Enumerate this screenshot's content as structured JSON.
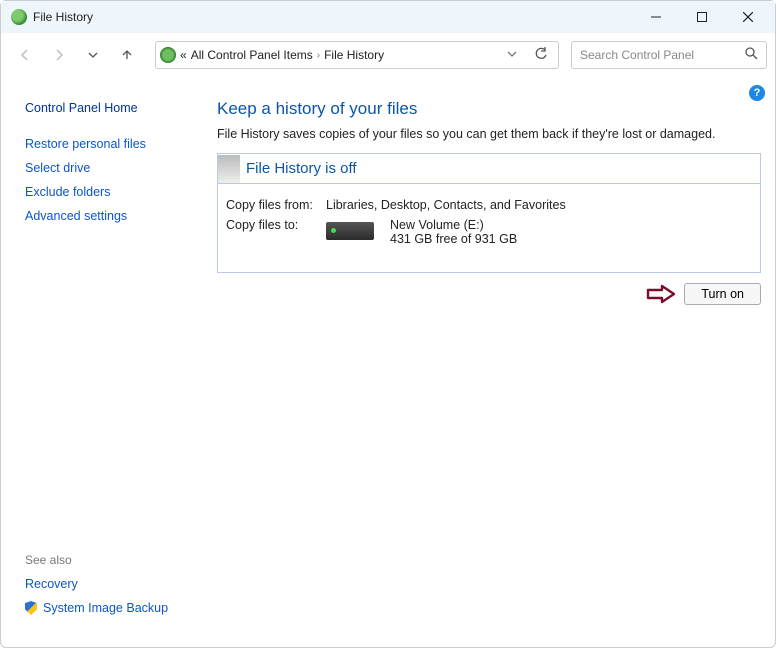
{
  "titlebar": {
    "title": "File History"
  },
  "breadcrumb": {
    "prefix": "«",
    "item1": "All Control Panel Items",
    "item2": "File History"
  },
  "search": {
    "placeholder": "Search Control Panel"
  },
  "sidebar": {
    "home": "Control Panel Home",
    "links": {
      "restore": "Restore personal files",
      "select_drive": "Select drive",
      "exclude": "Exclude folders",
      "advanced": "Advanced settings"
    },
    "see_also_label": "See also",
    "footer": {
      "recovery": "Recovery",
      "sib": "System Image Backup"
    }
  },
  "main": {
    "heading": "Keep a history of your files",
    "desc": "File History saves copies of your files so you can get them back if they're lost or damaged.",
    "status": "File History is off",
    "copy_from_label": "Copy files from:",
    "copy_from_value": "Libraries, Desktop, Contacts, and Favorites",
    "copy_to_label": "Copy files to:",
    "drive_name": "New Volume (E:)",
    "drive_free": "431 GB free of 931 GB",
    "turn_on": "Turn on"
  }
}
